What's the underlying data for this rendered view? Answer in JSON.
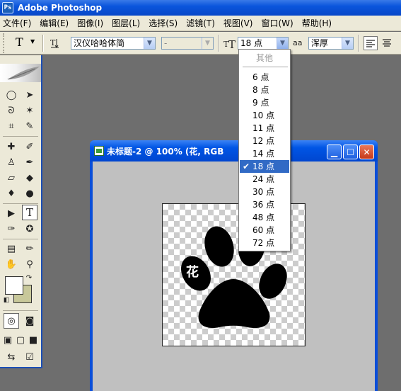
{
  "app": {
    "title": "Adobe Photoshop",
    "icon": "photoshop-icon",
    "icon_text": "Ps"
  },
  "menubar": {
    "items": [
      "文件(F)",
      "编辑(E)",
      "图像(I)",
      "图层(L)",
      "选择(S)",
      "滤镜(T)",
      "视图(V)",
      "窗口(W)",
      "帮助(H)"
    ]
  },
  "options": {
    "tool_glyph": "T",
    "font_family": "汉仪哈哈体简",
    "font_style": "-",
    "font_size": "18 点",
    "antialias_label": "aa",
    "antialias": "浑厚"
  },
  "document": {
    "title": "未标题-2 @ 100% (花, RGB",
    "glyph": "花"
  },
  "font_size_menu": {
    "header": "其他",
    "items": [
      "6 点",
      "8 点",
      "9 点",
      "10 点",
      "11 点",
      "12 点",
      "14 点",
      "18 点",
      "24 点",
      "30 点",
      "36 点",
      "48 点",
      "60 点",
      "72 点"
    ],
    "selected_index": 7,
    "check": "✔"
  },
  "colors": {
    "accent": "#316ac5",
    "titlebar": "#0a55dc",
    "background_swatch": "#c8c89a",
    "foreground_swatch": "#ffffff"
  }
}
